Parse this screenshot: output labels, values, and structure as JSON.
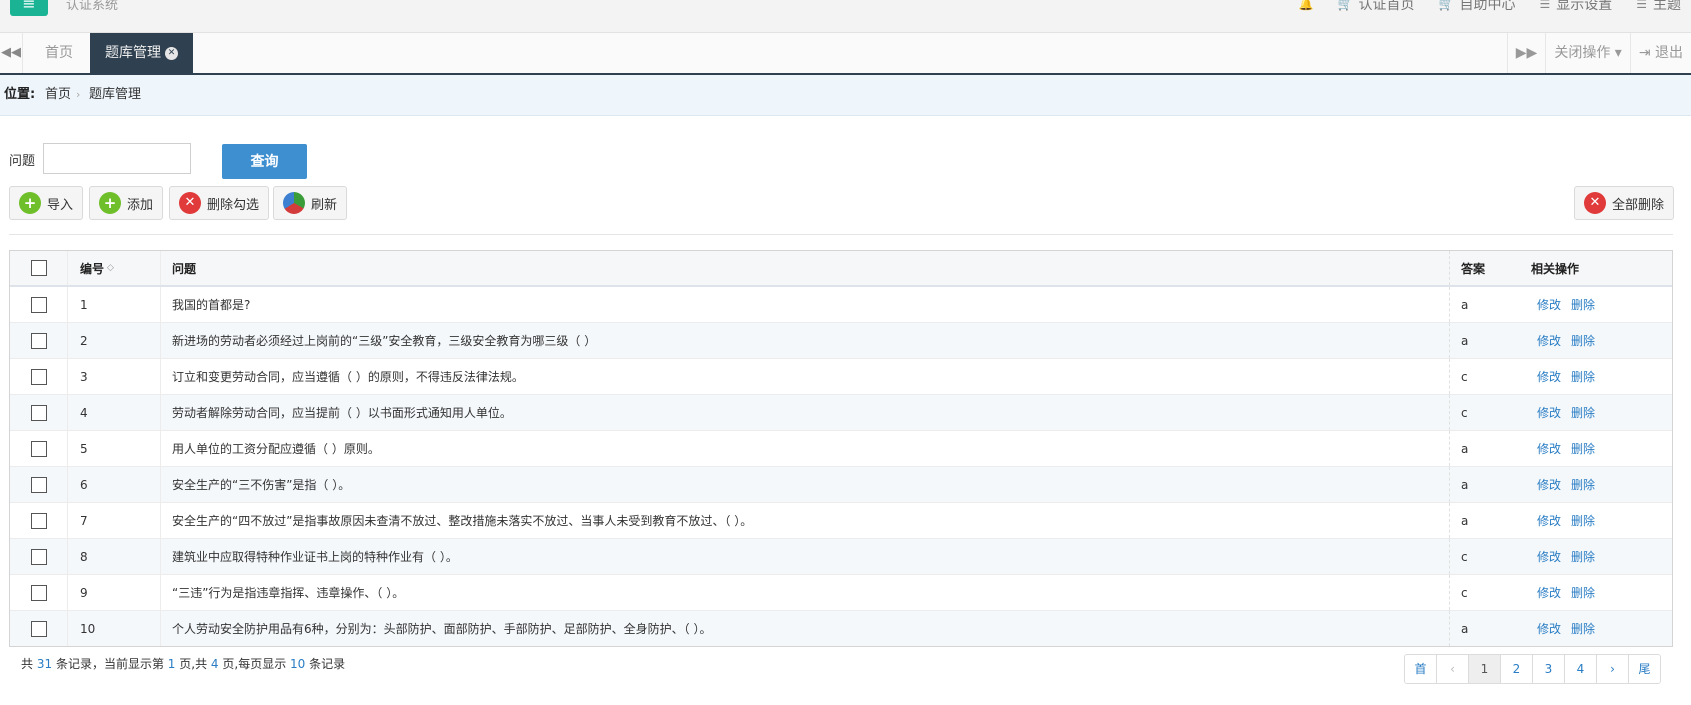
{
  "header": {
    "system_title": "认证系统",
    "nav": [
      {
        "label": "认证首页",
        "icon": "cart-icon"
      },
      {
        "label": "自助中心",
        "icon": "cart-icon"
      },
      {
        "label": "显示设置",
        "icon": "list-icon"
      },
      {
        "label": "主题",
        "icon": "list-icon"
      }
    ]
  },
  "tabs": {
    "home": "首页",
    "active": "题库管理",
    "close_ops": "关闭操作",
    "logout": "退出"
  },
  "breadcrumb": {
    "label": "位置:",
    "home": "首页",
    "current": "题库管理"
  },
  "search": {
    "label": "问题",
    "value": "",
    "query_button": "查询"
  },
  "toolbar": {
    "import": "导入",
    "add": "添加",
    "delete_selected": "删除勾选",
    "refresh": "刷新",
    "delete_all": "全部删除"
  },
  "table": {
    "headers": {
      "id": "编号",
      "question": "问题",
      "answer": "答案",
      "ops": "相关操作"
    },
    "edit_label": "修改",
    "delete_label": "删除",
    "rows": [
      {
        "id": "1",
        "question": "我国的首都是?",
        "answer": "a"
      },
      {
        "id": "2",
        "question": "新进场的劳动者必须经过上岗前的“三级”安全教育，三级安全教育为哪三级（ ）",
        "answer": "a"
      },
      {
        "id": "3",
        "question": "订立和变更劳动合同，应当遵循（ ）的原则，不得违反法律法规。",
        "answer": "c"
      },
      {
        "id": "4",
        "question": "劳动者解除劳动合同，应当提前（ ）以书面形式通知用人单位。",
        "answer": "c"
      },
      {
        "id": "5",
        "question": "用人单位的工资分配应遵循（ ）原则。",
        "answer": "a"
      },
      {
        "id": "6",
        "question": "安全生产的“三不伤害”是指（ ）。",
        "answer": "a"
      },
      {
        "id": "7",
        "question": "安全生产的“四不放过”是指事故原因未查清不放过、整改措施未落实不放过、当事人未受到教育不放过、（ ）。",
        "answer": "a"
      },
      {
        "id": "8",
        "question": "建筑业中应取得特种作业证书上岗的特种作业有（ ）。",
        "answer": "c"
      },
      {
        "id": "9",
        "question": "“三违”行为是指违章指挥、违章操作、（ ）。",
        "answer": "c"
      },
      {
        "id": "10",
        "question": "个人劳动安全防护用品有6种，分别为：头部防护、面部防护、手部防护、足部防护、全身防护、（ ）。",
        "answer": "a"
      }
    ]
  },
  "footer": {
    "t1": "共",
    "total": "31",
    "t2": "条记录，当前显示第",
    "page": "1",
    "t3": "页,共",
    "pages": "4",
    "t4": "页,每页显示",
    "per_page": "10",
    "t5": "条记录"
  },
  "pager": {
    "first": "首",
    "prev": "‹",
    "pages": [
      "1",
      "2",
      "3",
      "4"
    ],
    "next": "›",
    "last": "尾"
  }
}
